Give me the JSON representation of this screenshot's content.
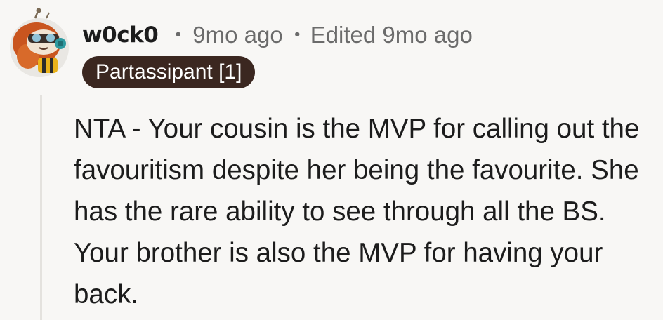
{
  "comment": {
    "username": "w0ck0",
    "separator": "•",
    "time_ago": "9mo ago",
    "edited": "Edited 9mo ago",
    "flair": "Partassipant [1]",
    "body": "NTA - Your cousin is the MVP for calling out the favouritism despite her being the favourite. She has the rare ability to see through all the BS. Your brother is also the MVP for having your back."
  },
  "colors": {
    "background": "#f8f7f5",
    "flair_bg": "#3b2720",
    "flair_text": "#ffffff",
    "meta_text": "#6b6b6b",
    "body_text": "#1c1c1c",
    "thread_line": "#e4e2de"
  },
  "icons": {
    "avatar": "snoo-avatar-icon"
  }
}
